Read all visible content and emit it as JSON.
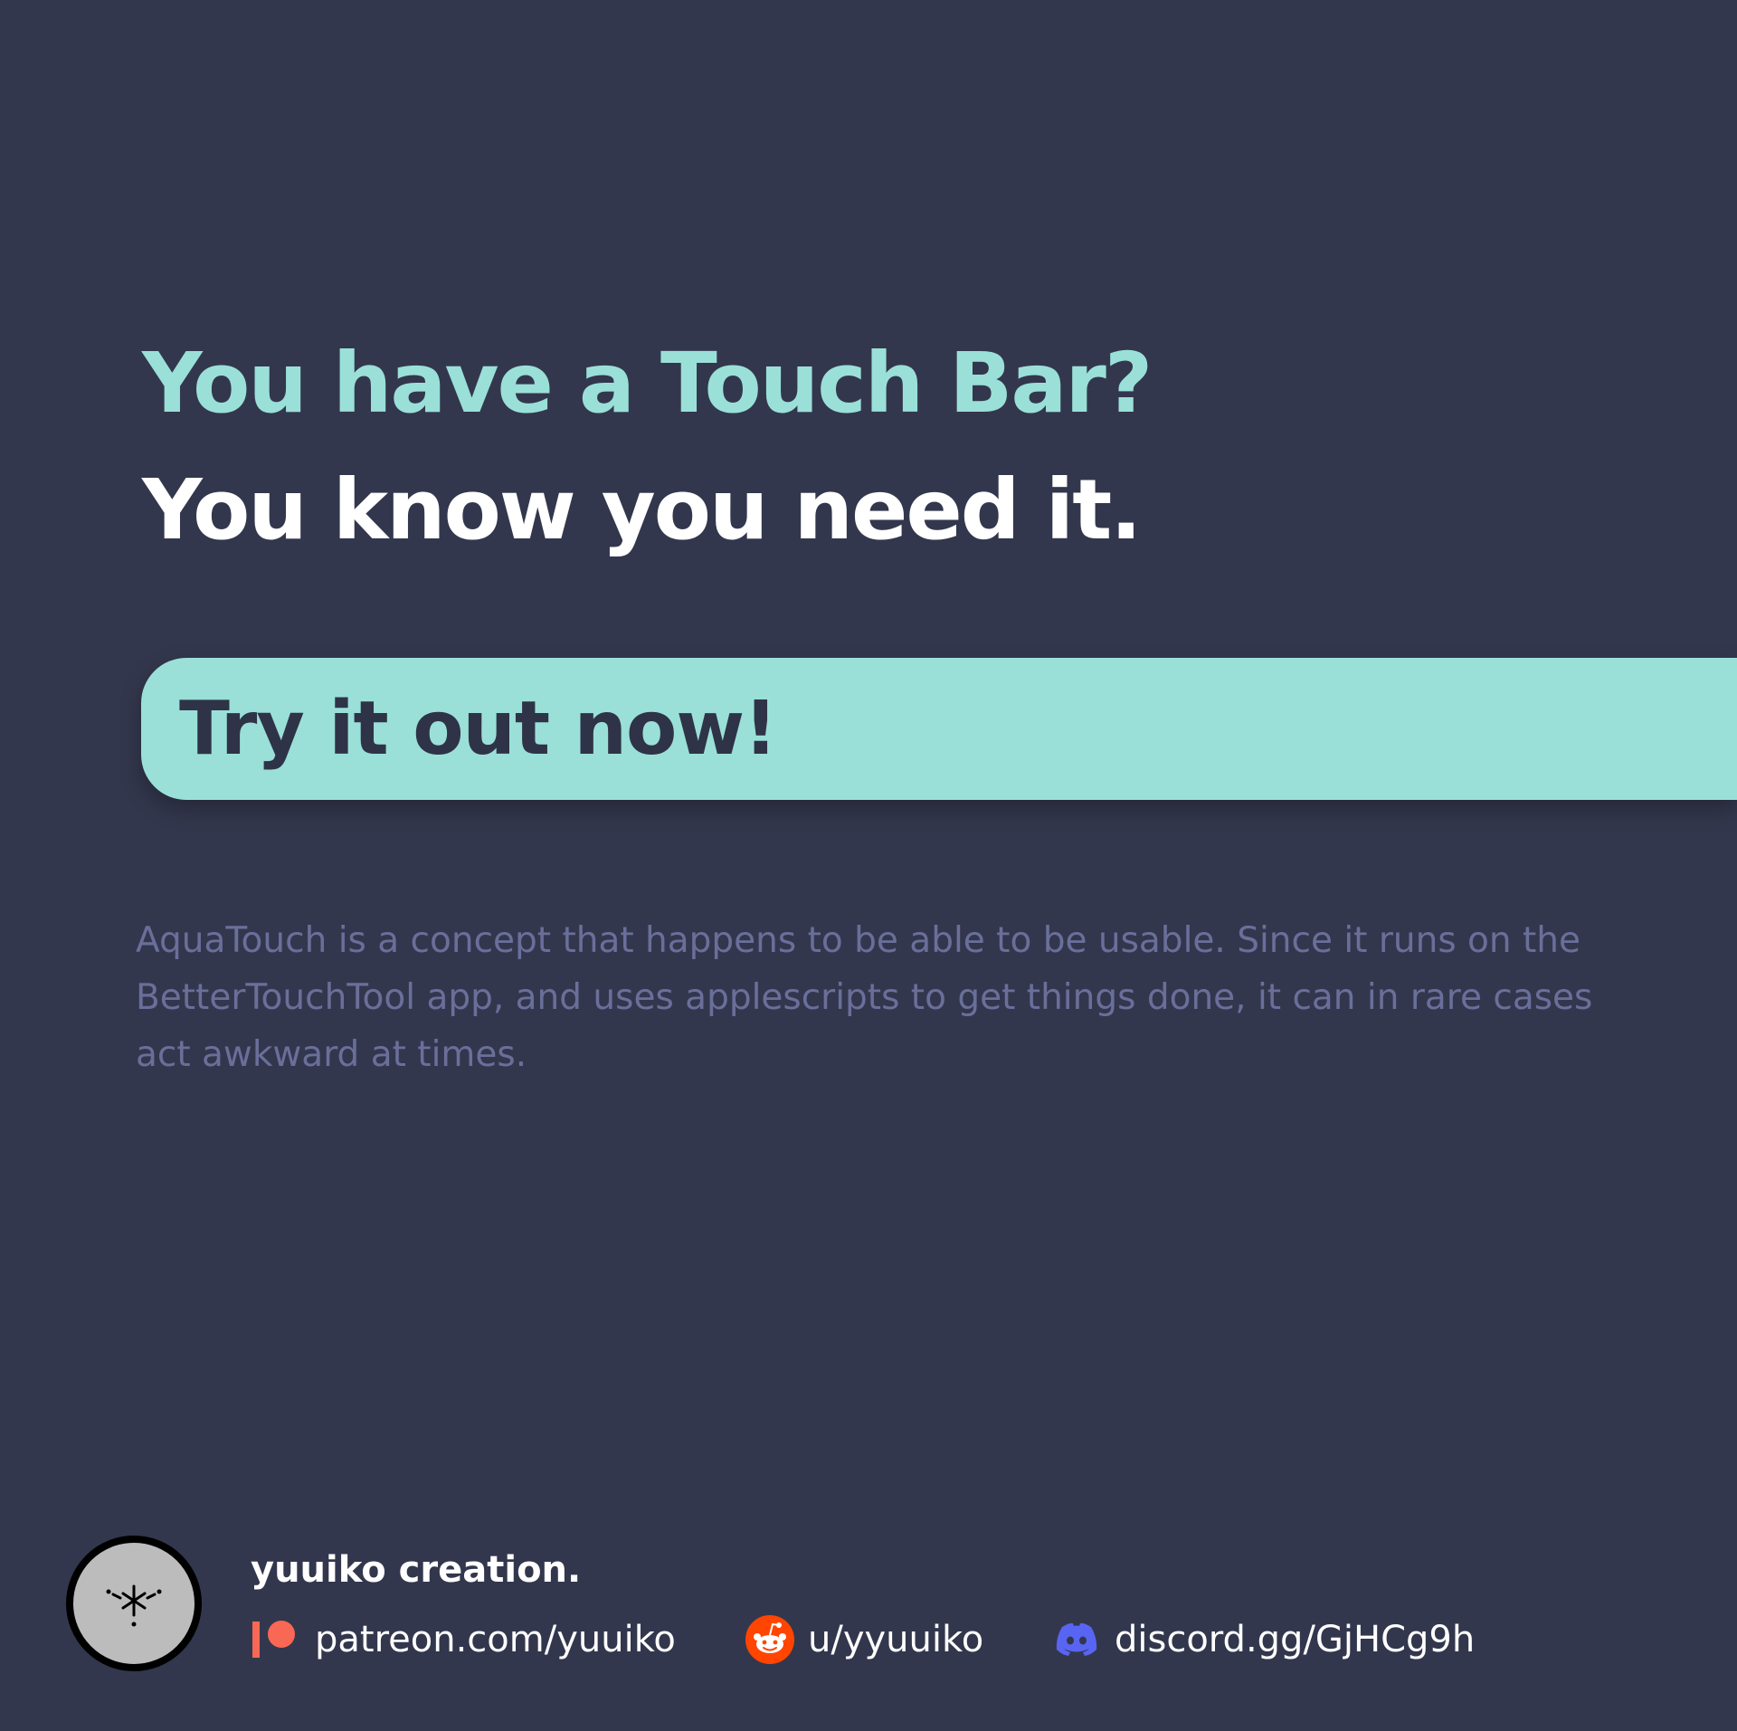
{
  "hero": {
    "line1": "You have a Touch Bar?",
    "line2": "You know you need it."
  },
  "cta": {
    "label": "Try it out now!"
  },
  "description": "AquaTouch is a concept that happens to be able to be usable. Since it runs on the BetterTouchTool app, and uses applescripts to get things done, it can in rare cases act awkward at times.",
  "footer": {
    "logo_icon": "yuuiko-logo",
    "title": "yuuiko creation.",
    "links": [
      {
        "icon": "patreon-icon",
        "label": "patreon.com/yuuiko"
      },
      {
        "icon": "reddit-icon",
        "label": "u/yyuuiko"
      },
      {
        "icon": "discord-icon",
        "label": "discord.gg/GjHCg9h"
      }
    ]
  },
  "colors": {
    "background": "#33374d",
    "accent": "#9ae0d8",
    "heading_white": "#ffffff",
    "cta_text": "#2f3348",
    "description_text": "#6a6f9a",
    "patreon": "#f96854",
    "reddit": "#ff4500",
    "discord": "#5865f2"
  }
}
